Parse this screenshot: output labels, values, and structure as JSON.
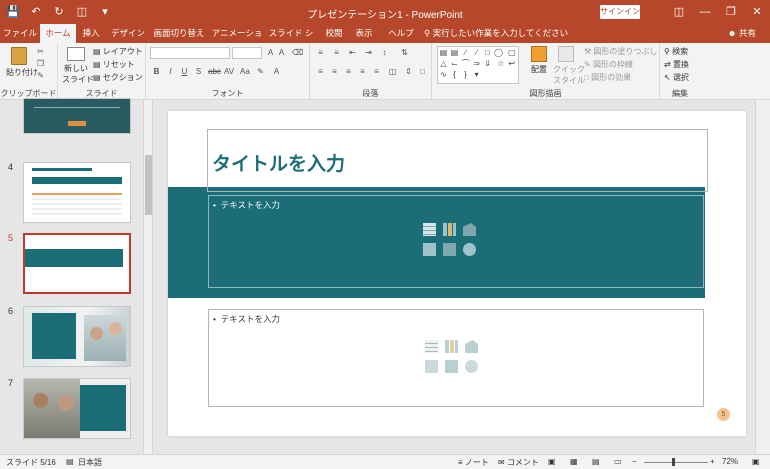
{
  "titlebar": {
    "title": "プレゼンテーション1  -  PowerPoint",
    "signin": "サインイン",
    "qat": [
      "save-icon",
      "undo-icon",
      "redo-icon",
      "start-from-beginning-icon",
      "customize-icon"
    ]
  },
  "tabs": [
    {
      "label": "ファイル"
    },
    {
      "label": "ホーム"
    },
    {
      "label": "挿入"
    },
    {
      "label": "デザイン"
    },
    {
      "label": "画面切り替え"
    },
    {
      "label": "アニメーション"
    },
    {
      "label": "スライド ショー"
    },
    {
      "label": "校閲"
    },
    {
      "label": "表示"
    },
    {
      "label": "ヘルプ"
    }
  ],
  "tellme": "実行したい作業を入力してください",
  "share": "共有",
  "ribbon": {
    "clipboard": {
      "paste": "貼り付け",
      "label": "クリップボード"
    },
    "slides": {
      "new_slide_1": "新しい",
      "new_slide_2": "スライド",
      "layout": "レイアウト",
      "reset": "リセット",
      "section": "セクション",
      "label": "スライド"
    },
    "font": {
      "label": "フォント"
    },
    "paragraph": {
      "label": "段落"
    },
    "drawing": {
      "arrange": "配置",
      "quick_styles_1": "クイック",
      "quick_styles_2": "スタイル",
      "fill": "図形の塗りつぶし",
      "outline": "図形の枠線",
      "effects": "図形の効果",
      "label": "図形描画"
    },
    "editing": {
      "find": "検索",
      "replace": "置換",
      "select": "選択",
      "label": "編集"
    }
  },
  "thumbnails": [
    {
      "num": "4"
    },
    {
      "num": "5"
    },
    {
      "num": "6"
    },
    {
      "num": "7"
    }
  ],
  "slide": {
    "title_placeholder": "タイトルを入力",
    "content_placeholder_1": "テキストを入力",
    "content_placeholder_2": "テキストを入力",
    "page_number": "5"
  },
  "statusbar": {
    "slide_info": "スライド 5/16",
    "language": "日本語",
    "notes": "ノート",
    "comments": "コメント",
    "zoom": "72%"
  },
  "colors": {
    "accent": "#b7472a",
    "teal": "#1b6d78"
  }
}
